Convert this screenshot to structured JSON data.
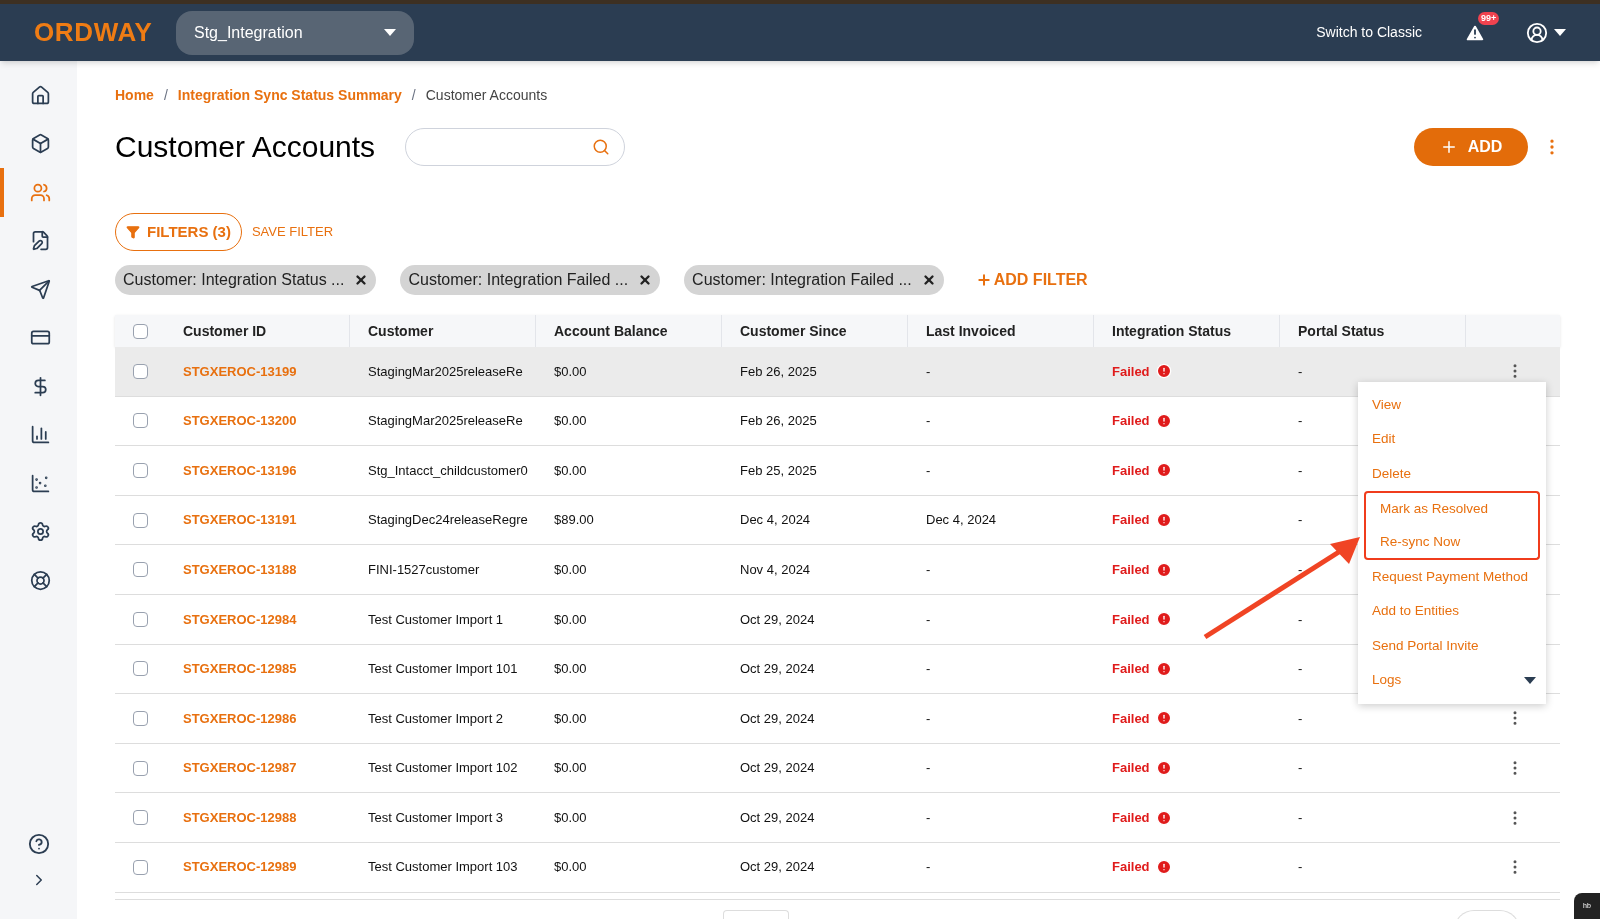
{
  "header": {
    "logo": "ORDWAY",
    "workspace": "Stg_Integration",
    "switch_link": "Switch to Classic",
    "alert_badge": "99+"
  },
  "sidebar": {
    "items": [
      {
        "selected": false
      },
      {
        "selected": false
      },
      {
        "selected": true
      },
      {
        "selected": false
      },
      {
        "selected": false
      },
      {
        "selected": false
      },
      {
        "selected": false
      },
      {
        "selected": false
      },
      {
        "selected": false
      },
      {
        "selected": false
      },
      {
        "selected": false
      }
    ]
  },
  "breadcrumbs": [
    {
      "kind": "link",
      "label": "Home"
    },
    {
      "kind": "separator",
      "label": "/"
    },
    {
      "kind": "link",
      "label": "Integration Sync Status Summary"
    },
    {
      "kind": "separator",
      "label": "/"
    },
    {
      "kind": "current",
      "label": "Customer Accounts"
    }
  ],
  "title": "Customer Accounts",
  "add_button": "ADD",
  "filters": {
    "button": "FILTERS (3)",
    "save": "SAVE FILTER",
    "chips": [
      "Customer: Integration Status ...",
      "Customer: Integration Failed ...",
      "Customer: Integration Failed ..."
    ],
    "add": "ADD FILTER"
  },
  "table": {
    "all_checked": false,
    "columns": [
      "Customer ID",
      "Customer",
      "Account Balance",
      "Customer Since",
      "Last Invoiced",
      "Integration Status",
      "Portal Status"
    ],
    "rows": [
      {
        "checked": false,
        "hovered": true,
        "cells": [
          "STGXEROC-13199",
          "StagingMar2025releaseRe",
          "$0.00",
          "Feb 26, 2025",
          "-",
          "Failed",
          "-"
        ]
      },
      {
        "checked": false,
        "hovered": false,
        "cells": [
          "STGXEROC-13200",
          "StagingMar2025releaseRe",
          "$0.00",
          "Feb 26, 2025",
          "-",
          "Failed",
          "-"
        ]
      },
      {
        "checked": false,
        "hovered": false,
        "cells": [
          "STGXEROC-13196",
          "Stg_Intacct_childcustomer0",
          "$0.00",
          "Feb 25, 2025",
          "-",
          "Failed",
          "-"
        ]
      },
      {
        "checked": false,
        "hovered": false,
        "cells": [
          "STGXEROC-13191",
          "StagingDec24releaseRegre",
          "$89.00",
          "Dec 4, 2024",
          "Dec 4, 2024",
          "Failed",
          "-"
        ]
      },
      {
        "checked": false,
        "hovered": false,
        "cells": [
          "STGXEROC-13188",
          "FINI-1527customer",
          "$0.00",
          "Nov 4, 2024",
          "-",
          "Failed",
          "-"
        ]
      },
      {
        "checked": false,
        "hovered": false,
        "cells": [
          "STGXEROC-12984",
          "Test Customer Import 1",
          "$0.00",
          "Oct 29, 2024",
          "-",
          "Failed",
          "-"
        ]
      },
      {
        "checked": false,
        "hovered": false,
        "cells": [
          "STGXEROC-12985",
          "Test Customer Import 101",
          "$0.00",
          "Oct 29, 2024",
          "-",
          "Failed",
          "-"
        ]
      },
      {
        "checked": false,
        "hovered": false,
        "cells": [
          "STGXEROC-12986",
          "Test Customer Import 2",
          "$0.00",
          "Oct 29, 2024",
          "-",
          "Failed",
          "-"
        ]
      },
      {
        "checked": false,
        "hovered": false,
        "cells": [
          "STGXEROC-12987",
          "Test Customer Import 102",
          "$0.00",
          "Oct 29, 2024",
          "-",
          "Failed",
          "-"
        ]
      },
      {
        "checked": false,
        "hovered": false,
        "cells": [
          "STGXEROC-12988",
          "Test Customer Import 3",
          "$0.00",
          "Oct 29, 2024",
          "-",
          "Failed",
          "-"
        ]
      },
      {
        "checked": false,
        "hovered": false,
        "cells": [
          "STGXEROC-12989",
          "Test Customer Import 103",
          "$0.00",
          "Oct 29, 2024",
          "-",
          "Failed",
          "-"
        ]
      }
    ]
  },
  "row_menu": {
    "items": [
      {
        "label": "View",
        "highlighted": false,
        "kind": "item"
      },
      {
        "label": "Edit",
        "highlighted": false,
        "kind": "item"
      },
      {
        "label": "Delete",
        "highlighted": false,
        "kind": "item"
      },
      {
        "label": "Mark as Resolved",
        "highlighted": true,
        "kind": "item"
      },
      {
        "label": "Re-sync Now",
        "highlighted": true,
        "kind": "item"
      },
      {
        "label": "Request Payment Method",
        "highlighted": false,
        "kind": "item"
      },
      {
        "label": "Add to Entities",
        "highlighted": false,
        "kind": "item"
      },
      {
        "label": "Send Portal Invite",
        "highlighted": false,
        "kind": "item"
      },
      {
        "label": "Logs",
        "highlighted": false,
        "kind": "submenu"
      }
    ]
  },
  "corner_badge": "hb"
}
